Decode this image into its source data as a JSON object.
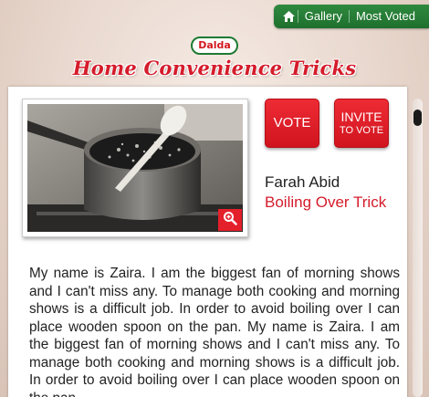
{
  "nav": {
    "home_icon": "home-icon",
    "items": [
      "Gallery",
      "Most Voted"
    ]
  },
  "brand": {
    "logo_text": "Dalda",
    "site_title": "Home Convenience Tricks"
  },
  "entry": {
    "image_desc_icon": "zoom-icon",
    "vote_label": "VOTE",
    "invite_label_line1": "INVITE",
    "invite_label_line2": "TO VOTE",
    "author": "Farah Abid",
    "trick_title": "Boiling Over Trick",
    "story": "My name is Zaira. I am the biggest fan of morning shows and I can't miss any. To manage both cooking and morning shows is a difficult job. In order to avoid boiling over I can place wooden spoon on the pan. My name is Zaira. I am the biggest fan of morning shows and I can't miss any. To manage both cooking and morning shows is a difficult job. In order to avoid boiling over I can place wooden spoon on the pan."
  },
  "colors": {
    "nav_green": "#1e6f2d",
    "brand_red": "#d51c2b",
    "button_red": "#e4202b"
  }
}
